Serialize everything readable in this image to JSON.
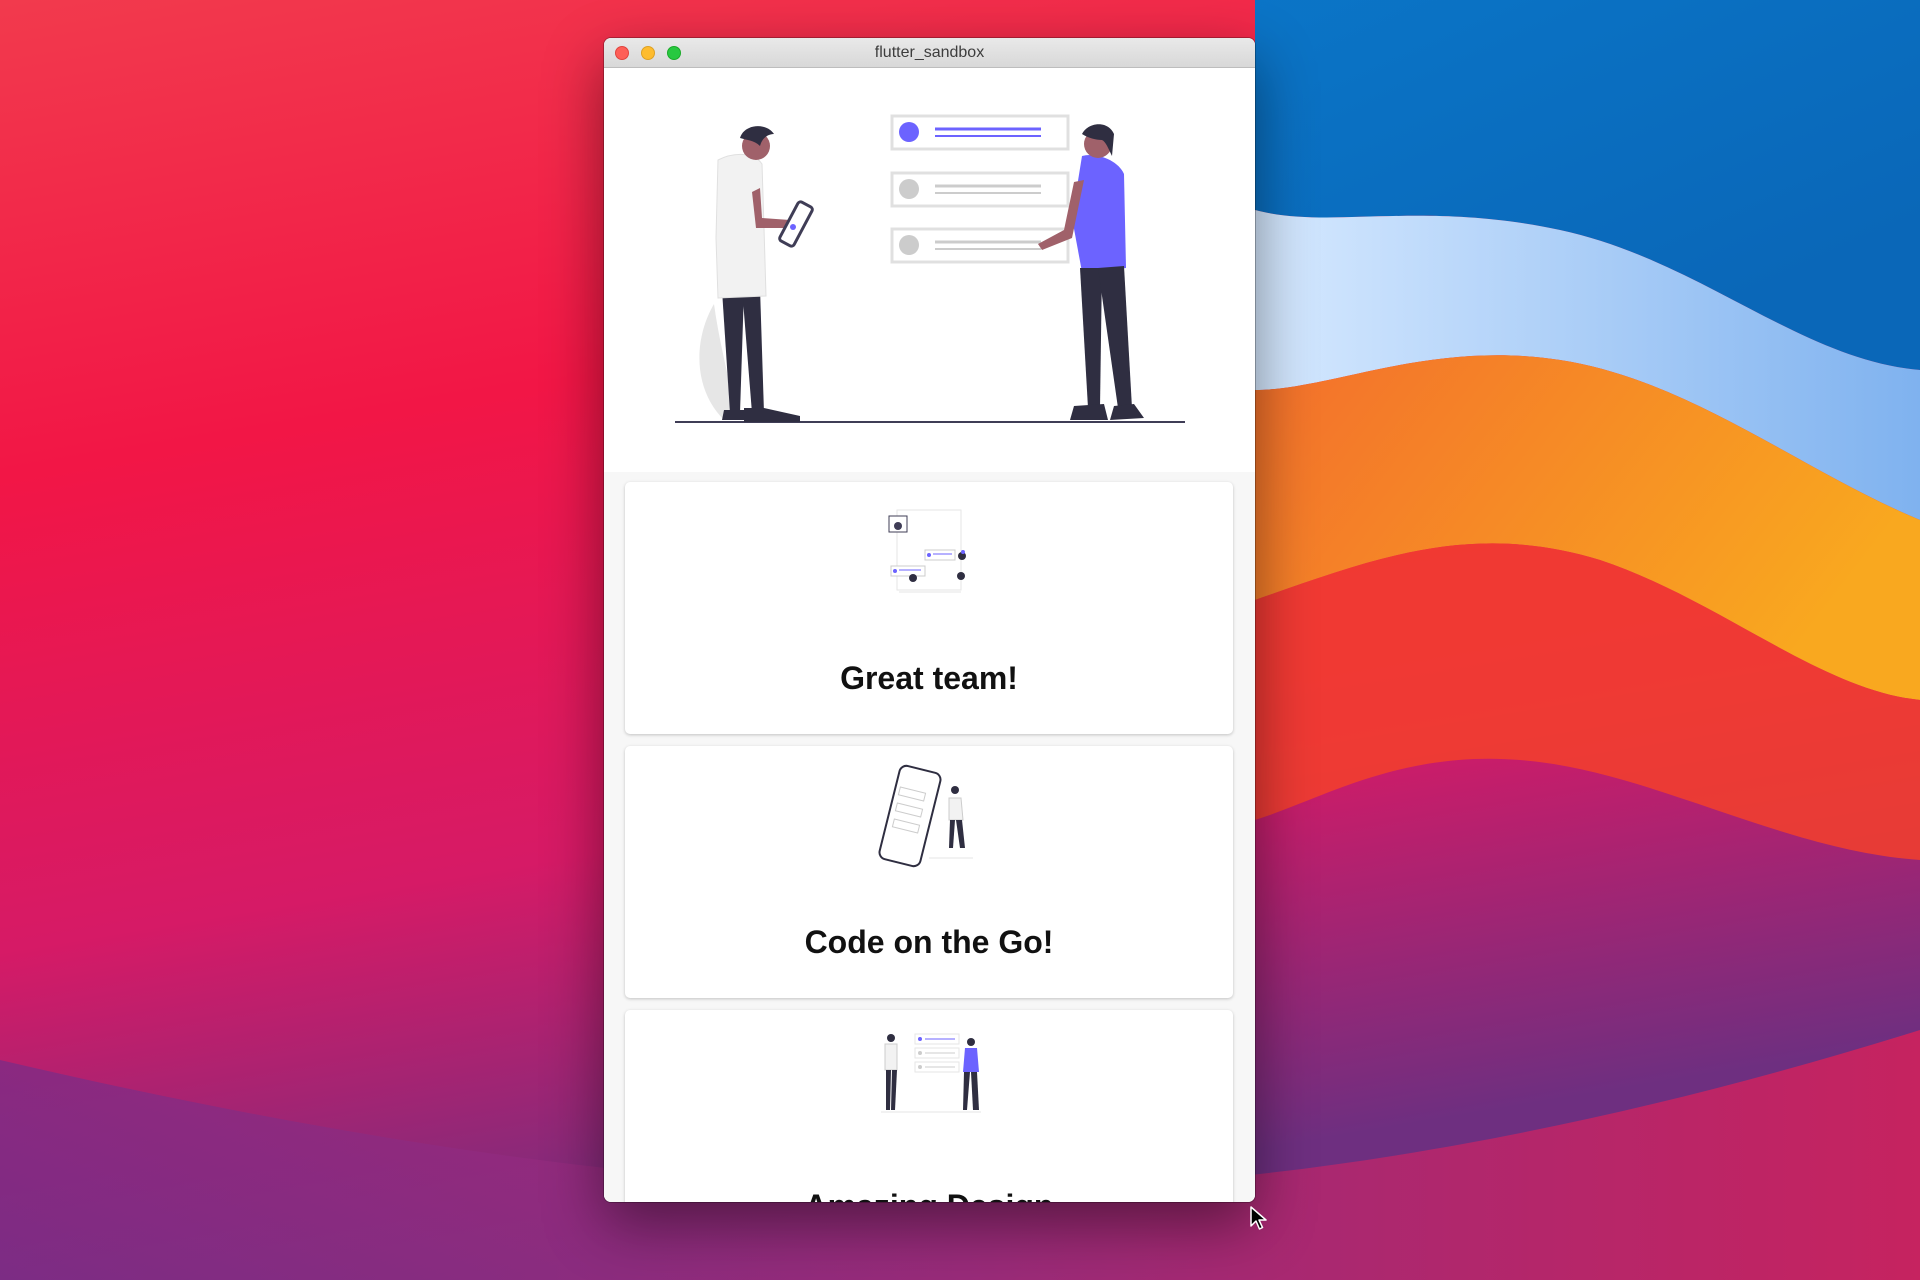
{
  "window": {
    "title": "flutter_sandbox"
  },
  "cards": [
    {
      "title": "Great team!",
      "illustration": "team-collaboration-illustration"
    },
    {
      "title": "Code on the Go!",
      "illustration": "mobile-app-illustration"
    },
    {
      "title": "Amazing Design",
      "illustration": "design-review-illustration"
    }
  ],
  "hero": {
    "illustration": "people-reviewing-list-illustration"
  },
  "colors": {
    "accent": "#6c63ff",
    "dark": "#2f2e41",
    "skin": "#a0616a",
    "gray": "#e6e6e6"
  }
}
